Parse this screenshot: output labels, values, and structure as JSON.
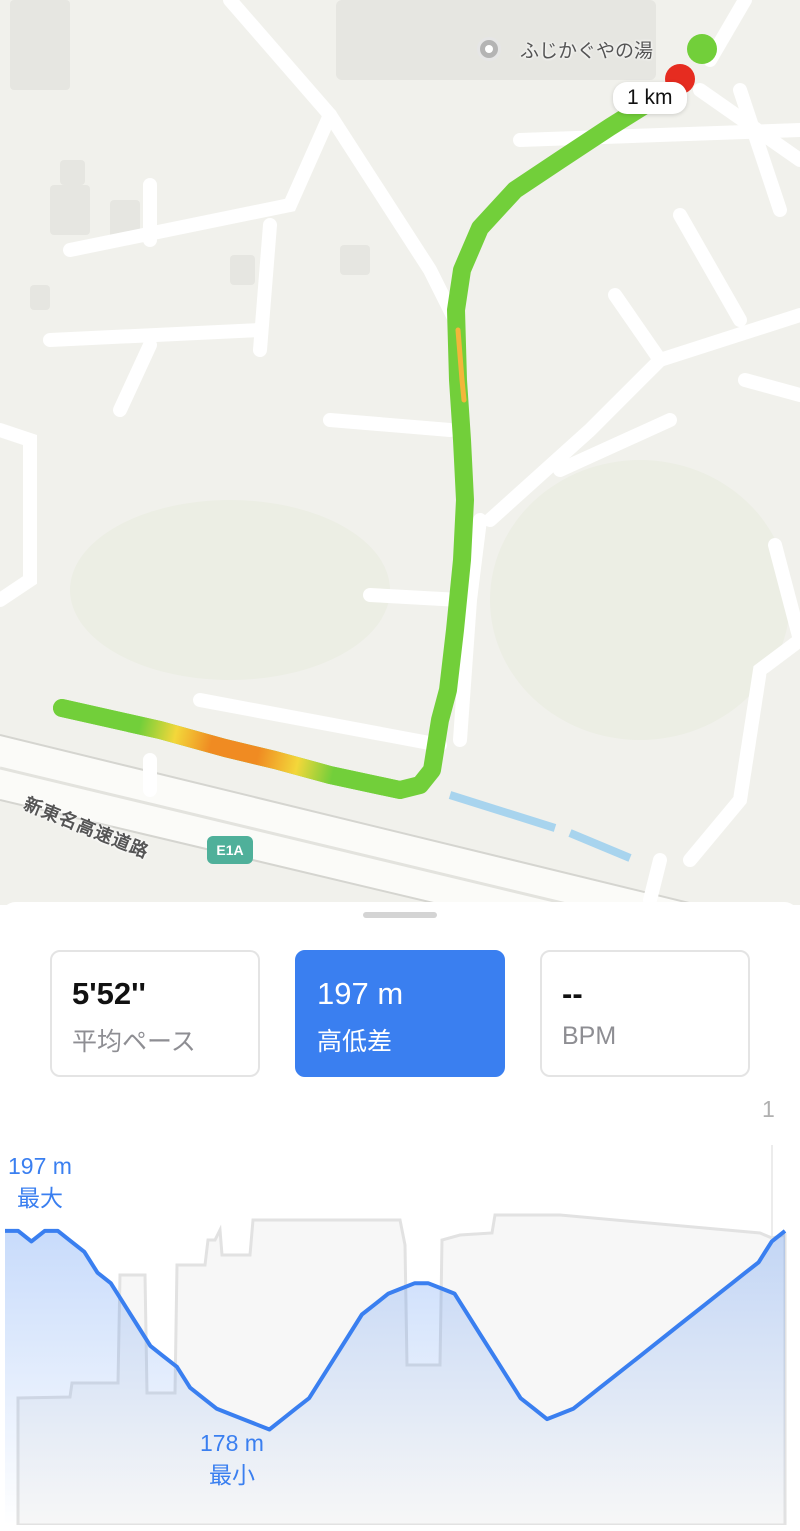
{
  "map": {
    "poi_label": "ふじかぐやの湯",
    "distance_badge": "1 km",
    "road_name": "新東名高速道路",
    "road_shield": "E1A",
    "colors": {
      "route_green": "#72cf3a",
      "route_yellow": "#f3d73a",
      "route_orange": "#f08b22",
      "start": "#72cf3a",
      "end": "#e62c20",
      "shield": "#4fb09a"
    }
  },
  "stats": [
    {
      "value": "5'52''",
      "label": "平均ペース",
      "active": false
    },
    {
      "value": "197 m",
      "label": "高低差",
      "active": true
    },
    {
      "value": "--",
      "label": "BPM",
      "active": false
    }
  ],
  "chart": {
    "page_indicator": "1",
    "max_value": "197 m",
    "max_label": "最大",
    "min_value": "178 m",
    "min_label": "最小",
    "accent_color": "#3a7ff0"
  },
  "chart_data": {
    "type": "line",
    "series": [
      {
        "values": [
          197,
          197,
          196,
          197,
          197,
          196,
          195,
          193,
          192,
          190,
          188,
          186,
          185,
          184,
          182,
          181,
          180,
          179.5,
          179,
          178.5,
          178,
          179,
          180,
          181,
          183,
          185,
          187,
          189,
          190,
          191,
          191.5,
          192,
          192,
          191.5,
          191,
          189,
          187,
          185,
          183,
          181,
          180,
          179,
          179.5,
          180,
          181,
          182,
          183,
          184,
          185,
          186,
          187,
          188,
          189,
          190,
          191,
          192,
          193,
          194,
          196,
          197
        ]
      }
    ],
    "ylim": [
      177,
      199
    ],
    "annotations": [
      "197 m 最大",
      "178 m 最小"
    ]
  }
}
